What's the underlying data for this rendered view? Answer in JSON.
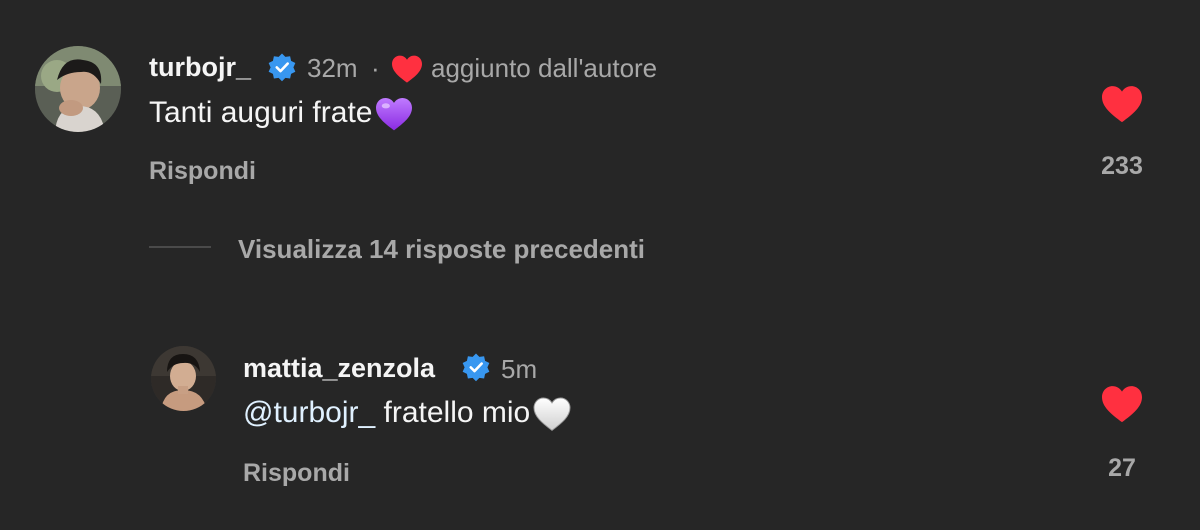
{
  "comments": [
    {
      "username": "turbojr_",
      "time": "32m",
      "separator": "·",
      "author_like_label": "aggiunto dall'autore",
      "text": "Tanti auguri frate",
      "emoji": "purple-heart",
      "reply_label": "Rispondi",
      "like_count": "233"
    }
  ],
  "view_replies_label": "Visualizza 14 risposte precedenti",
  "reply": {
    "username": "mattia_zenzola",
    "time": "5m",
    "mention": "@turbojr_",
    "text": " fratello mio",
    "emoji": "white-heart",
    "reply_label": "Rispondi",
    "like_count": "27"
  },
  "colors": {
    "background": "#262626",
    "like_red": "#ff3040",
    "verified_blue": "#3897f0",
    "secondary_text": "#a8a8a8",
    "purple_heart": "#a64dff"
  }
}
